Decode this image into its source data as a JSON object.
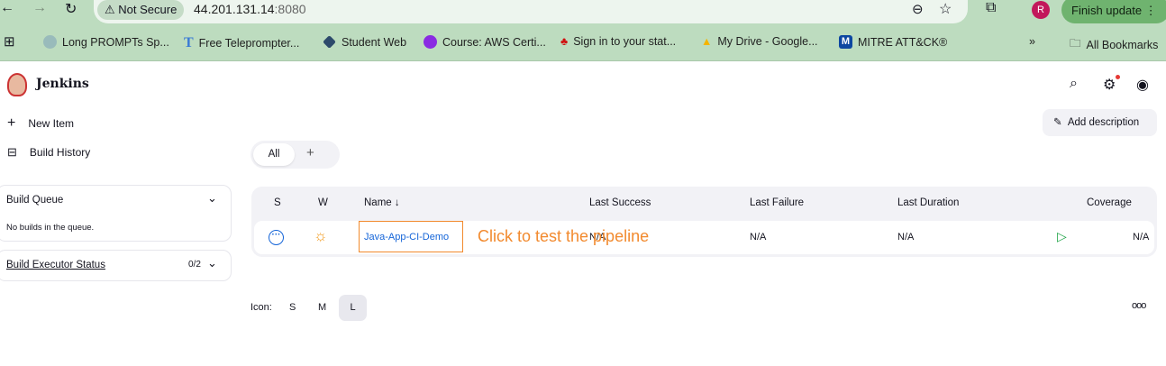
{
  "browser": {
    "security": "Not Secure",
    "url_host": "44.201.131.14",
    "url_port": ":8080",
    "finish_update": "Finish update",
    "profile_initial": "R",
    "bookmarks": [
      "Long PROMPTs Sp...",
      "Free Teleprompter...",
      "Student Web",
      "Course: AWS Certi...",
      "Sign in to your stat...",
      "My Drive - Google...",
      "MITRE ATT&CK®"
    ],
    "more": "»",
    "all_bookmarks": "All Bookmarks"
  },
  "header": {
    "title": "Jenkins"
  },
  "sidebar": {
    "new_item": "New Item",
    "build_history": "Build History",
    "build_queue": "Build Queue",
    "queue_empty": "No builds in the queue.",
    "executor_status": "Build Executor Status",
    "executor_count": "0/2"
  },
  "main": {
    "add_description": "Add description",
    "tabs": [
      "All",
      "+"
    ],
    "columns": [
      "S",
      "W",
      "Name ↓",
      "Last Success",
      "Last Failure",
      "Last Duration",
      "Coverage"
    ],
    "job": {
      "name": "Java-App-CI-Demo",
      "last_success": "N/A",
      "last_failure": "N/A",
      "last_duration": "N/A",
      "coverage": "N/A"
    },
    "annotation": "Click to test the pipeline",
    "icon_label": "Icon:",
    "icon_sizes": [
      "S",
      "M",
      "L"
    ]
  },
  "colors": {
    "link": "#1565d8",
    "annotation": "#f28a2e",
    "weather": "#f29b1f",
    "run": "#1ea446"
  }
}
